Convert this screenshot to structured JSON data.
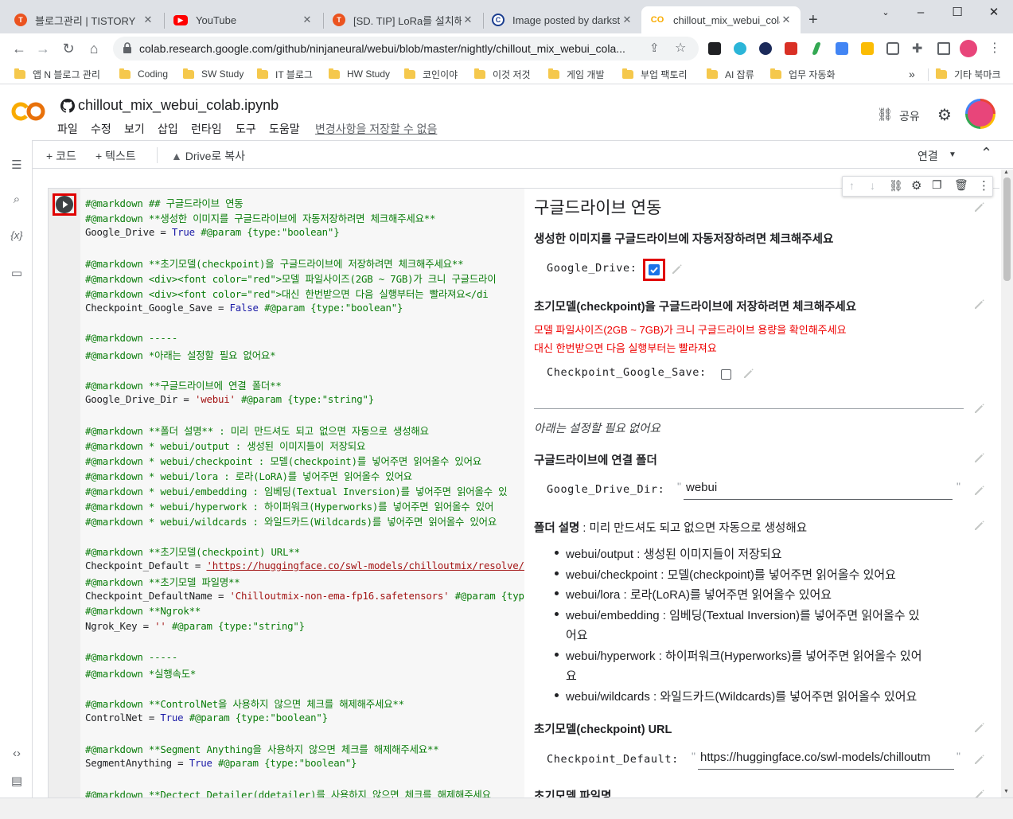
{
  "browser": {
    "tabs": [
      {
        "title": "블로그관리 | TISTORY",
        "icon": "tistory-icon",
        "color": "#eb531f"
      },
      {
        "title": "YouTube",
        "icon": "youtube-icon",
        "color": "#ff0000"
      },
      {
        "title": "[SD. TIP] LoRa를 설치해",
        "icon": "tistory-icon",
        "color": "#eb531f"
      },
      {
        "title": "Image posted by darkst",
        "icon": "civitai-icon",
        "color": "#1a3d8f"
      },
      {
        "title": "chillout_mix_webui_colab",
        "icon": "colab-icon",
        "color": "#f9ab00"
      }
    ],
    "new_tab_icon": "plus-icon",
    "url": "colab.research.google.com/github/ninjaneural/webui/blob/master/nightly/chillout_mix_webui_cola...",
    "bookmarks": [
      "앱 N 블로그 관리",
      "Coding",
      "SW Study",
      "IT 블로그",
      "HW Study",
      "코인이야",
      "이것 저것",
      "게임 개발",
      "부업 팩토리",
      "AI 잡류",
      "업무 자동화"
    ],
    "bookmarks_overflow": "»",
    "other_bookmarks": "기타 북마크"
  },
  "colab": {
    "notebook_title": "chillout_mix_webui_colab.ipynb",
    "menu": [
      "파일",
      "수정",
      "보기",
      "삽입",
      "런타임",
      "도구",
      "도움말"
    ],
    "save_notice": "변경사항을 저장할 수 없음",
    "share_label": "공유",
    "toolbar": {
      "code": "+ 코드",
      "text": "+ 텍스트",
      "copy_drive": "Drive로 복사",
      "connect": "연결"
    }
  },
  "code_lines": [
    [
      {
        "c": "#@markdown ## 구글드라이브 연동"
      }
    ],
    [
      {
        "c": "#@markdown **생성한 이미지를 구글드라이브에 자동저장하려면 체크해주세요**"
      }
    ],
    [
      {
        "k": "Google_Drive = "
      },
      {
        "b": "True"
      },
      {
        "c": " #@param {type:\"boolean\"}"
      }
    ],
    [],
    [
      {
        "c": "#@markdown **초기모델(checkpoint)을 구글드라이브에 저장하려면 체크해주세요**"
      }
    ],
    [
      {
        "c": "#@markdown <div><font color=\"red\">모델 파일사이즈(2GB ~ 7GB)가 크니 구글드라이"
      }
    ],
    [
      {
        "c": "#@markdown <div><font color=\"red\">대신 한번받으면 다음 실행부터는 빨라져요</di"
      }
    ],
    [
      {
        "k": "Checkpoint_Google_Save = "
      },
      {
        "b": "False"
      },
      {
        "c": " #@param {type:\"boolean\"}"
      }
    ],
    [],
    [
      {
        "c": "#@markdown -----"
      }
    ],
    [
      {
        "c": "#@markdown *아래는 설정할 필요 없어요*"
      }
    ],
    [],
    [
      {
        "c": "#@markdown **구글드라이브에 연결 폴더**"
      }
    ],
    [
      {
        "k": "Google_Drive_Dir = "
      },
      {
        "s": "'webui'"
      },
      {
        "c": " #@param {type:\"string\"}"
      }
    ],
    [],
    [
      {
        "c": "#@markdown **폴더 설명** : 미리 만드셔도 되고 없으면 자동으로 생성해요"
      }
    ],
    [
      {
        "c": "#@markdown * webui/output : 생성된 이미지들이 저장되요"
      }
    ],
    [
      {
        "c": "#@markdown * webui/checkpoint : 모델(checkpoint)를 넣어주면 읽어올수 있어요"
      }
    ],
    [
      {
        "c": "#@markdown * webui/lora : 로라(LoRA)를 넣어주면 읽어올수 있어요"
      }
    ],
    [
      {
        "c": "#@markdown * webui/embedding : 임베딩(Textual Inversion)를 넣어주면 읽어올수 있"
      }
    ],
    [
      {
        "c": "#@markdown * webui/hyperwork : 하이퍼워크(Hyperworks)를 넣어주면 읽어올수 있어"
      }
    ],
    [
      {
        "c": "#@markdown * webui/wildcards : 와일드카드(Wildcards)를 넣어주면 읽어올수 있어요"
      }
    ],
    [],
    [
      {
        "c": "#@markdown **초기모델(checkpoint) URL**"
      }
    ],
    [
      {
        "k": "Checkpoint_Default = "
      },
      {
        "u": "'https://huggingface.co/swl-models/chilloutmix/resolve/ma"
      }
    ],
    [
      {
        "c": "#@markdown **초기모델 파일명**"
      }
    ],
    [
      {
        "k": "Checkpoint_DefaultName = "
      },
      {
        "s": "'Chilloutmix-non-ema-fp16.safetensors'"
      },
      {
        "c": " #@param {type:"
      }
    ],
    [
      {
        "c": "#@markdown **Ngrok**"
      }
    ],
    [
      {
        "k": "Ngrok_Key = "
      },
      {
        "s": "''"
      },
      {
        "c": " #@param {type:\"string\"}"
      }
    ],
    [],
    [
      {
        "c": "#@markdown -----"
      }
    ],
    [
      {
        "c": "#@markdown *실행속도*"
      }
    ],
    [],
    [
      {
        "c": "#@markdown **ControlNet을 사용하지 않으면 체크를 해제해주세요**"
      }
    ],
    [
      {
        "k": "ControlNet = "
      },
      {
        "b": "True"
      },
      {
        "c": " #@param {type:\"boolean\"}"
      }
    ],
    [],
    [
      {
        "c": "#@markdown **Segment Anything을 사용하지 않으면 체크를 해제해주세요**"
      }
    ],
    [
      {
        "k": "SegmentAnything = "
      },
      {
        "b": "True"
      },
      {
        "c": " #@param {type:\"boolean\"}"
      }
    ],
    [],
    [
      {
        "c": "#@markdown **Dectect Detailer(ddetailer)를 사용하지 않으면 체크를 해제해주세요"
      }
    ]
  ],
  "form": {
    "heading": "구글드라이브 연동",
    "drive_desc": "생성한 이미지를 구글드라이브에 자동저장하려면 체크해주세요",
    "google_drive_label": "Google_Drive:",
    "google_drive_checked": true,
    "checkpoint_desc": "초기모델(checkpoint)을 구글드라이브에 저장하려면 체크해주세요",
    "red_note_1": "모델 파일사이즈(2GB ~ 7GB)가 크니 구글드라이브 용량을 확인해주세요",
    "red_note_2": "대신 한번받으면 다음 실행부터는 빨라져요",
    "checkpoint_save_label": "Checkpoint_Google_Save:",
    "checkpoint_save_checked": false,
    "note_italic": "아래는 설정할 필요 없어요",
    "folder_heading": "구글드라이브에 연결 폴더",
    "drive_dir_label": "Google_Drive_Dir:",
    "drive_dir_value": "webui",
    "folder_desc_bold": "폴더 설명",
    "folder_desc_rest": " : 미리 만드셔도 되고 없으면 자동으로 생성해요",
    "folders": [
      [
        "webui/output : 생성된 이미지들이 저장되요"
      ],
      [
        "webui/checkpoint : 모델(checkpoint)를 넣어주면 읽어올수 있어요"
      ],
      [
        "webui/lora : 로라(LoRA)를 넣어주면 읽어올수 있어요"
      ],
      [
        "webui/embedding : 임베딩(Textual Inversion)를 넣어주면 읽어올수 있",
        "어요"
      ],
      [
        "webui/hyperwork : 하이퍼워크(Hyperworks)를 넣어주면 읽어올수 있어",
        "요"
      ],
      [
        "webui/wildcards : 와일드카드(Wildcards)를 넣어주면 읽어올수 있어요"
      ]
    ],
    "url_heading": "초기모델(checkpoint) URL",
    "checkpoint_default_label": "Checkpoint_Default:",
    "checkpoint_default_value": "https://huggingface.co/swl-models/chilloutm",
    "name_heading": "초기모델 파일명",
    "quote": "\""
  },
  "colors": {
    "highlight": "#e00000",
    "colab_orange": "#f9ab00",
    "link_blue": "#1a73e8"
  }
}
